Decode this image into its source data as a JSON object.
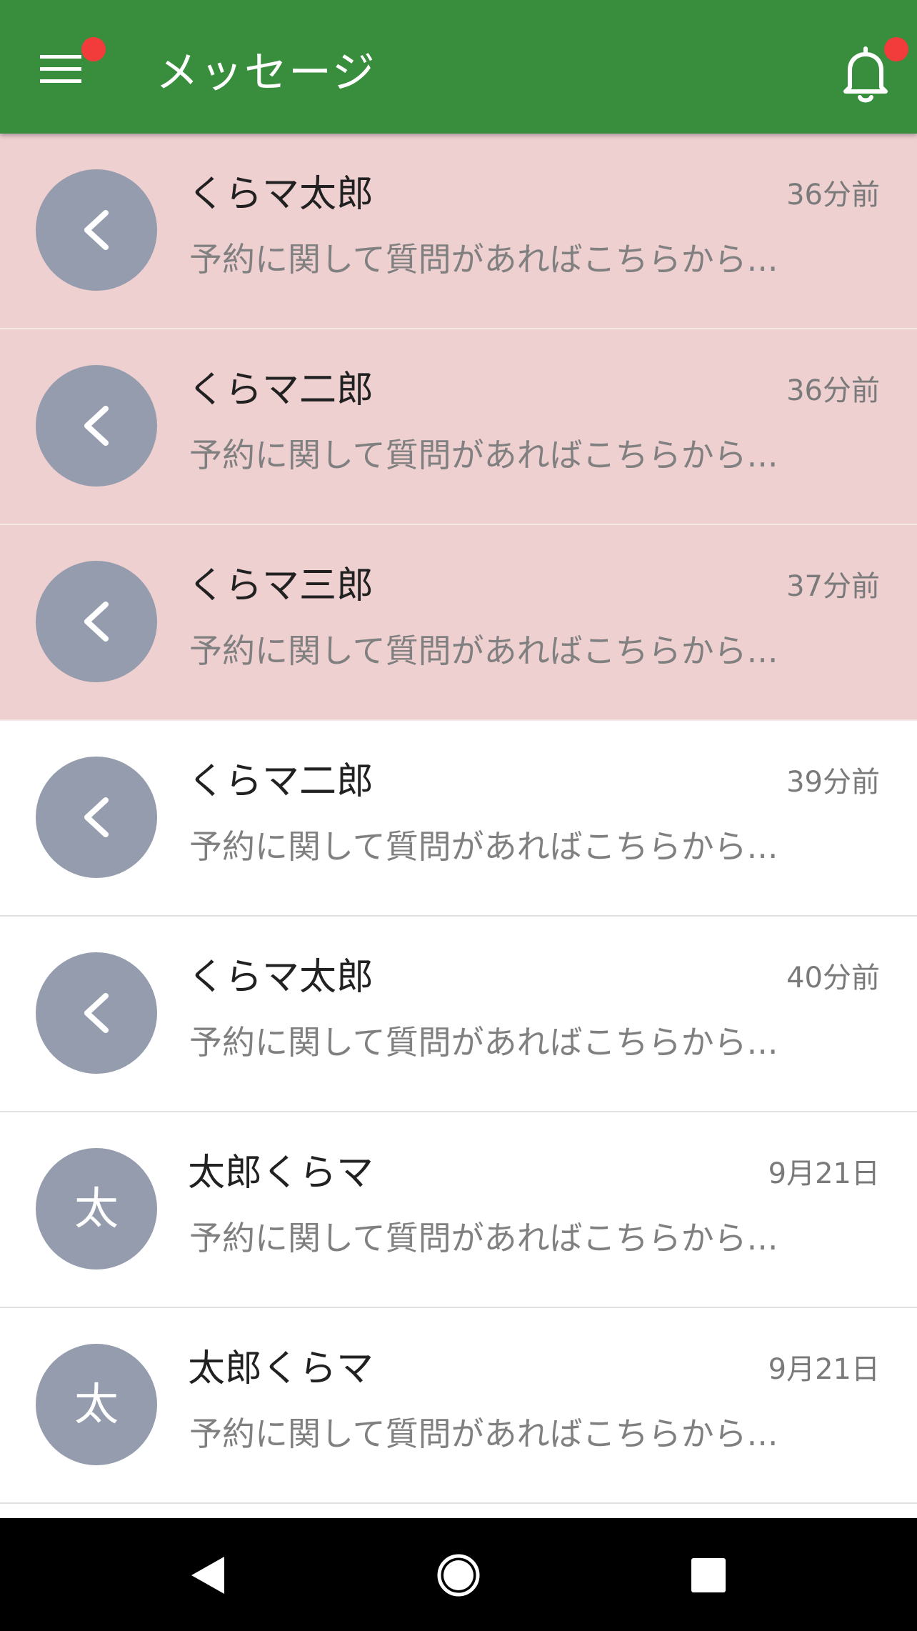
{
  "header": {
    "title": "メッセージ",
    "color": "#388e3c",
    "menu_icon": "menu-icon",
    "bell_icon": "bell-icon",
    "badge_color": "#f23b3b"
  },
  "messages": [
    {
      "avatar": "chevron-left-icon",
      "avatar_text": "",
      "name": "くらマ太郎",
      "time": "36分前",
      "preview": "予約に関して質問があればこちらから...",
      "unread": true
    },
    {
      "avatar": "chevron-left-icon",
      "avatar_text": "",
      "name": "くらマ二郎",
      "time": "36分前",
      "preview": "予約に関して質問があればこちらから...",
      "unread": true
    },
    {
      "avatar": "chevron-left-icon",
      "avatar_text": "",
      "name": "くらマ三郎",
      "time": "37分前",
      "preview": "予約に関して質問があればこちらから...",
      "unread": true
    },
    {
      "avatar": "chevron-left-icon",
      "avatar_text": "",
      "name": "くらマ二郎",
      "time": "39分前",
      "preview": "予約に関して質問があればこちらから...",
      "unread": false
    },
    {
      "avatar": "chevron-left-icon",
      "avatar_text": "",
      "name": "くらマ太郎",
      "time": "40分前",
      "preview": "予約に関して質問があればこちらから...",
      "unread": false
    },
    {
      "avatar": "text",
      "avatar_text": "太",
      "name": "太郎くらマ",
      "time": "9月21日",
      "preview": "予約に関して質問があればこちらから...",
      "unread": false
    },
    {
      "avatar": "text",
      "avatar_text": "太",
      "name": "太郎くらマ",
      "time": "9月21日",
      "preview": "予約に関して質問があればこちらから...",
      "unread": false
    }
  ],
  "colors": {
    "unread_background": "#efd0d1",
    "avatar_background": "#949cae"
  },
  "system_nav": {
    "back_icon": "back-triangle-icon",
    "home_icon": "home-circle-icon",
    "recent_icon": "recent-apps-square-icon"
  }
}
